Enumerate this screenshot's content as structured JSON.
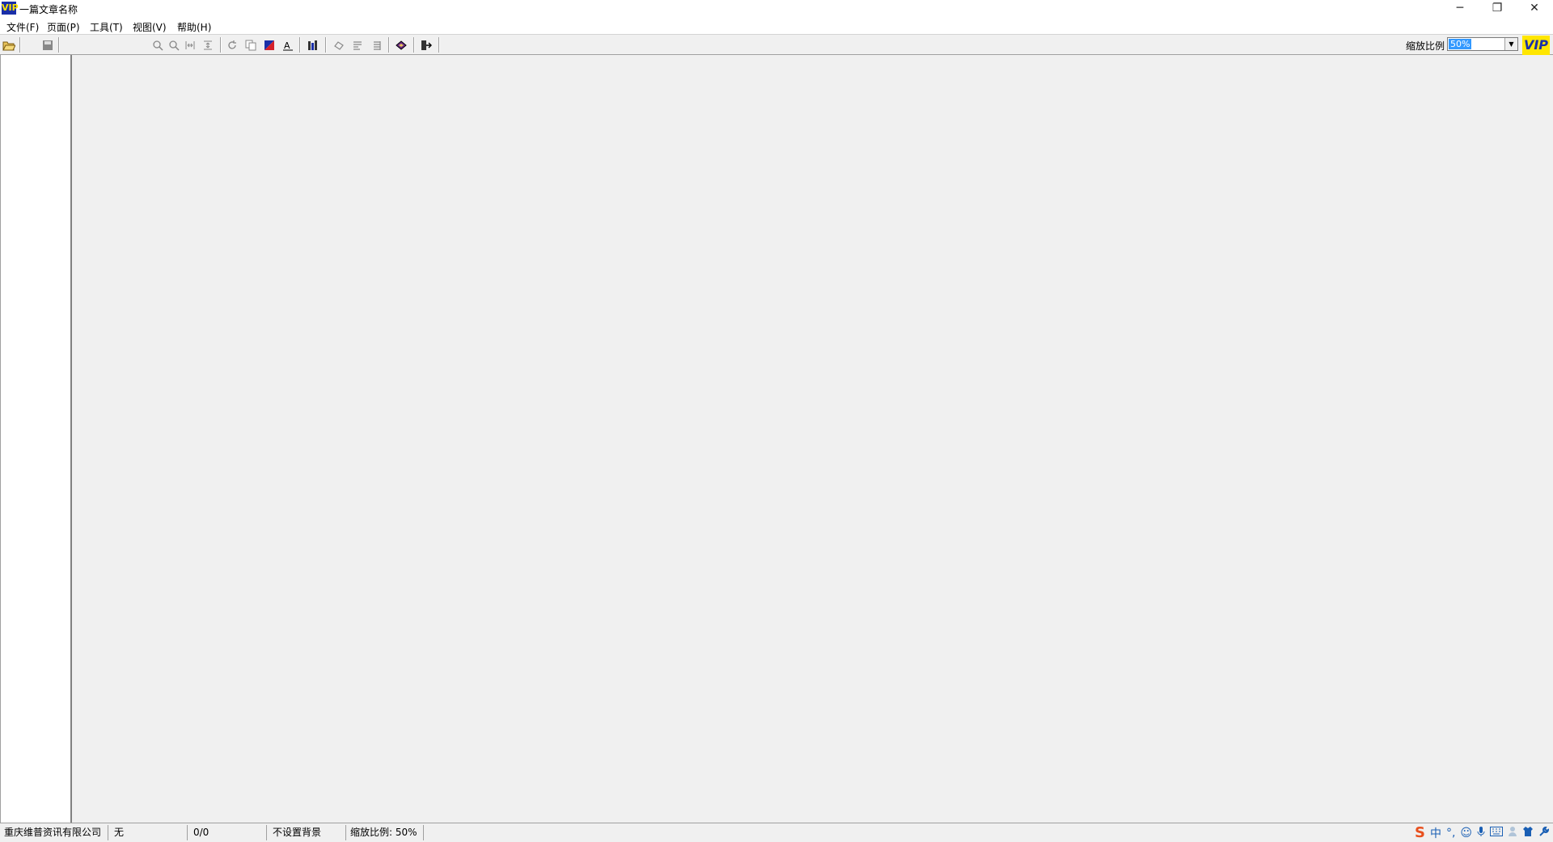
{
  "window": {
    "app_icon_text": "VIP",
    "title": "一篇文章名称",
    "minimize_glyph": "─",
    "restore_glyph": "❐",
    "close_glyph": "✕"
  },
  "menu": {
    "items": [
      "文件(F)",
      "页面(P)",
      "工具(T)",
      "视图(V)",
      "帮助(H)"
    ]
  },
  "toolbar": {
    "icons": [
      "open-icon",
      "save-icon",
      "zoom-in-icon",
      "zoom-out-icon",
      "fit-width-icon",
      "fit-page-icon",
      "rotate-icon",
      "copy-icon",
      "color-icon",
      "text-icon",
      "columns-icon",
      "hand-icon",
      "page-prev-icon",
      "page-next-icon",
      "book-icon",
      "exit-icon"
    ],
    "zoom_label": "缩放比例",
    "zoom_value": "50%",
    "vip_logo": "VIP"
  },
  "statusbar": {
    "company": "重庆维普资讯有限公司",
    "status": "无",
    "page": "0/0",
    "background": "不设置背景",
    "zoom": "缩放比例: 50%"
  },
  "ime": {
    "logo": "S",
    "mode": "中",
    "punct": "°,",
    "icons": [
      "emoji-icon",
      "microphone-icon",
      "keyboard-icon",
      "user-icon",
      "shirt-icon",
      "wrench-icon"
    ]
  },
  "colors": {
    "accent": "#3399ff",
    "logo_yellow": "#ffe600",
    "logo_blue": "#1a2fa8"
  }
}
